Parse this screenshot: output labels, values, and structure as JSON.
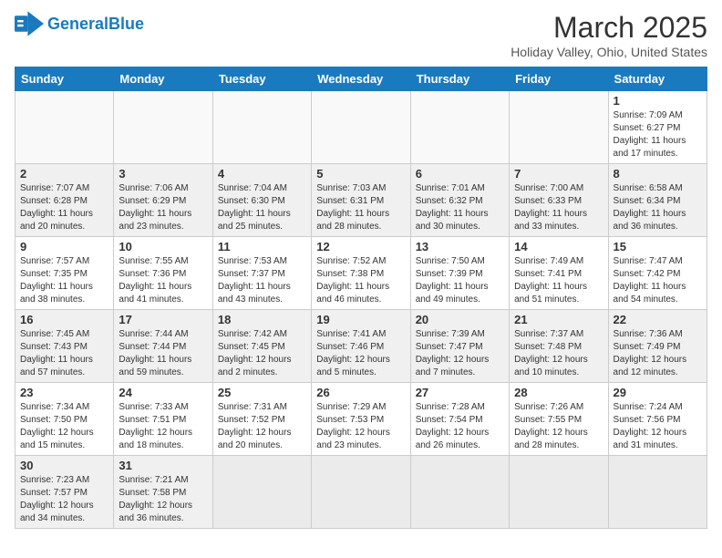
{
  "logo": {
    "text_general": "General",
    "text_blue": "Blue"
  },
  "header": {
    "month": "March 2025",
    "location": "Holiday Valley, Ohio, United States"
  },
  "days_of_week": [
    "Sunday",
    "Monday",
    "Tuesday",
    "Wednesday",
    "Thursday",
    "Friday",
    "Saturday"
  ],
  "weeks": [
    [
      {
        "day": "",
        "info": ""
      },
      {
        "day": "",
        "info": ""
      },
      {
        "day": "",
        "info": ""
      },
      {
        "day": "",
        "info": ""
      },
      {
        "day": "",
        "info": ""
      },
      {
        "day": "",
        "info": ""
      },
      {
        "day": "1",
        "info": "Sunrise: 7:09 AM\nSunset: 6:27 PM\nDaylight: 11 hours and 17 minutes."
      }
    ],
    [
      {
        "day": "2",
        "info": "Sunrise: 7:07 AM\nSunset: 6:28 PM\nDaylight: 11 hours and 20 minutes."
      },
      {
        "day": "3",
        "info": "Sunrise: 7:06 AM\nSunset: 6:29 PM\nDaylight: 11 hours and 23 minutes."
      },
      {
        "day": "4",
        "info": "Sunrise: 7:04 AM\nSunset: 6:30 PM\nDaylight: 11 hours and 25 minutes."
      },
      {
        "day": "5",
        "info": "Sunrise: 7:03 AM\nSunset: 6:31 PM\nDaylight: 11 hours and 28 minutes."
      },
      {
        "day": "6",
        "info": "Sunrise: 7:01 AM\nSunset: 6:32 PM\nDaylight: 11 hours and 30 minutes."
      },
      {
        "day": "7",
        "info": "Sunrise: 7:00 AM\nSunset: 6:33 PM\nDaylight: 11 hours and 33 minutes."
      },
      {
        "day": "8",
        "info": "Sunrise: 6:58 AM\nSunset: 6:34 PM\nDaylight: 11 hours and 36 minutes."
      }
    ],
    [
      {
        "day": "9",
        "info": "Sunrise: 7:57 AM\nSunset: 7:35 PM\nDaylight: 11 hours and 38 minutes."
      },
      {
        "day": "10",
        "info": "Sunrise: 7:55 AM\nSunset: 7:36 PM\nDaylight: 11 hours and 41 minutes."
      },
      {
        "day": "11",
        "info": "Sunrise: 7:53 AM\nSunset: 7:37 PM\nDaylight: 11 hours and 43 minutes."
      },
      {
        "day": "12",
        "info": "Sunrise: 7:52 AM\nSunset: 7:38 PM\nDaylight: 11 hours and 46 minutes."
      },
      {
        "day": "13",
        "info": "Sunrise: 7:50 AM\nSunset: 7:39 PM\nDaylight: 11 hours and 49 minutes."
      },
      {
        "day": "14",
        "info": "Sunrise: 7:49 AM\nSunset: 7:41 PM\nDaylight: 11 hours and 51 minutes."
      },
      {
        "day": "15",
        "info": "Sunrise: 7:47 AM\nSunset: 7:42 PM\nDaylight: 11 hours and 54 minutes."
      }
    ],
    [
      {
        "day": "16",
        "info": "Sunrise: 7:45 AM\nSunset: 7:43 PM\nDaylight: 11 hours and 57 minutes."
      },
      {
        "day": "17",
        "info": "Sunrise: 7:44 AM\nSunset: 7:44 PM\nDaylight: 11 hours and 59 minutes."
      },
      {
        "day": "18",
        "info": "Sunrise: 7:42 AM\nSunset: 7:45 PM\nDaylight: 12 hours and 2 minutes."
      },
      {
        "day": "19",
        "info": "Sunrise: 7:41 AM\nSunset: 7:46 PM\nDaylight: 12 hours and 5 minutes."
      },
      {
        "day": "20",
        "info": "Sunrise: 7:39 AM\nSunset: 7:47 PM\nDaylight: 12 hours and 7 minutes."
      },
      {
        "day": "21",
        "info": "Sunrise: 7:37 AM\nSunset: 7:48 PM\nDaylight: 12 hours and 10 minutes."
      },
      {
        "day": "22",
        "info": "Sunrise: 7:36 AM\nSunset: 7:49 PM\nDaylight: 12 hours and 12 minutes."
      }
    ],
    [
      {
        "day": "23",
        "info": "Sunrise: 7:34 AM\nSunset: 7:50 PM\nDaylight: 12 hours and 15 minutes."
      },
      {
        "day": "24",
        "info": "Sunrise: 7:33 AM\nSunset: 7:51 PM\nDaylight: 12 hours and 18 minutes."
      },
      {
        "day": "25",
        "info": "Sunrise: 7:31 AM\nSunset: 7:52 PM\nDaylight: 12 hours and 20 minutes."
      },
      {
        "day": "26",
        "info": "Sunrise: 7:29 AM\nSunset: 7:53 PM\nDaylight: 12 hours and 23 minutes."
      },
      {
        "day": "27",
        "info": "Sunrise: 7:28 AM\nSunset: 7:54 PM\nDaylight: 12 hours and 26 minutes."
      },
      {
        "day": "28",
        "info": "Sunrise: 7:26 AM\nSunset: 7:55 PM\nDaylight: 12 hours and 28 minutes."
      },
      {
        "day": "29",
        "info": "Sunrise: 7:24 AM\nSunset: 7:56 PM\nDaylight: 12 hours and 31 minutes."
      }
    ],
    [
      {
        "day": "30",
        "info": "Sunrise: 7:23 AM\nSunset: 7:57 PM\nDaylight: 12 hours and 34 minutes."
      },
      {
        "day": "31",
        "info": "Sunrise: 7:21 AM\nSunset: 7:58 PM\nDaylight: 12 hours and 36 minutes."
      },
      {
        "day": "",
        "info": ""
      },
      {
        "day": "",
        "info": ""
      },
      {
        "day": "",
        "info": ""
      },
      {
        "day": "",
        "info": ""
      },
      {
        "day": "",
        "info": ""
      }
    ]
  ]
}
